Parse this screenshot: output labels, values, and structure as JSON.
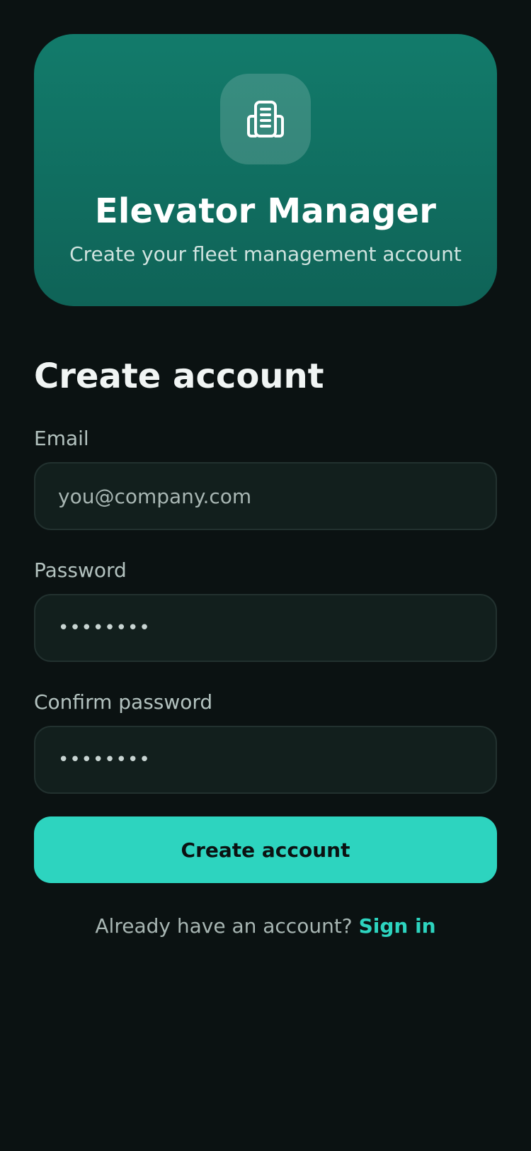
{
  "hero": {
    "icon": "building-icon",
    "title": "Elevator Manager",
    "subtitle": "Create your fleet management account"
  },
  "form": {
    "title": "Create account",
    "email": {
      "label": "Email",
      "placeholder": "you@company.com"
    },
    "password": {
      "label": "Password",
      "value": "••••••••"
    },
    "confirm_password": {
      "label": "Confirm password",
      "value": "••••••••"
    },
    "submit_label": "Create account"
  },
  "footer": {
    "prompt": "Already have an account?",
    "link_label": "Sign in"
  },
  "colors": {
    "background": "#0b1212",
    "hero_top": "#127b6b",
    "hero_bottom": "#0f6357",
    "accent": "#2dd4bf",
    "input_bg": "#121f1d"
  }
}
